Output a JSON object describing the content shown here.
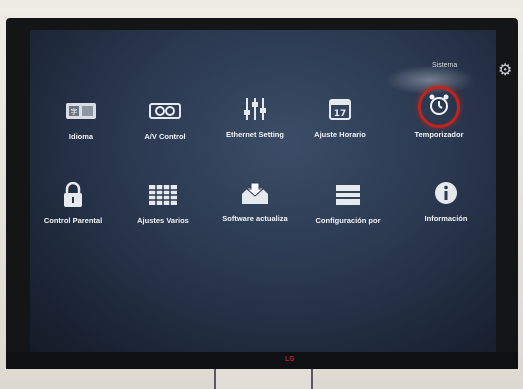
{
  "menu": {
    "section_label": "Sistema",
    "items": [
      {
        "label": "Idioma",
        "icon": "language-icon"
      },
      {
        "label": "A/V Control",
        "icon": "av-control-icon"
      },
      {
        "label": "Ethernet Setting",
        "icon": "sliders-icon"
      },
      {
        "label": "Ajuste Horario",
        "icon": "calendar-icon",
        "icon_text": "17"
      },
      {
        "label": "Temporizador",
        "icon": "alarm-clock-icon",
        "selected": true
      },
      {
        "label": "Control Parental",
        "icon": "lock-icon"
      },
      {
        "label": "Ajustes Varios",
        "icon": "grid-icon"
      },
      {
        "label": "Software actualiza",
        "icon": "software-update-icon"
      },
      {
        "label": "Configuración por",
        "icon": "reset-config-icon"
      },
      {
        "label": "Información",
        "icon": "info-icon"
      }
    ]
  },
  "tv": {
    "brand": "LG"
  },
  "colors": {
    "highlight_ring": "#c0241c",
    "screen_bg": "#2a3850",
    "label_text": "#f2f4f8"
  }
}
